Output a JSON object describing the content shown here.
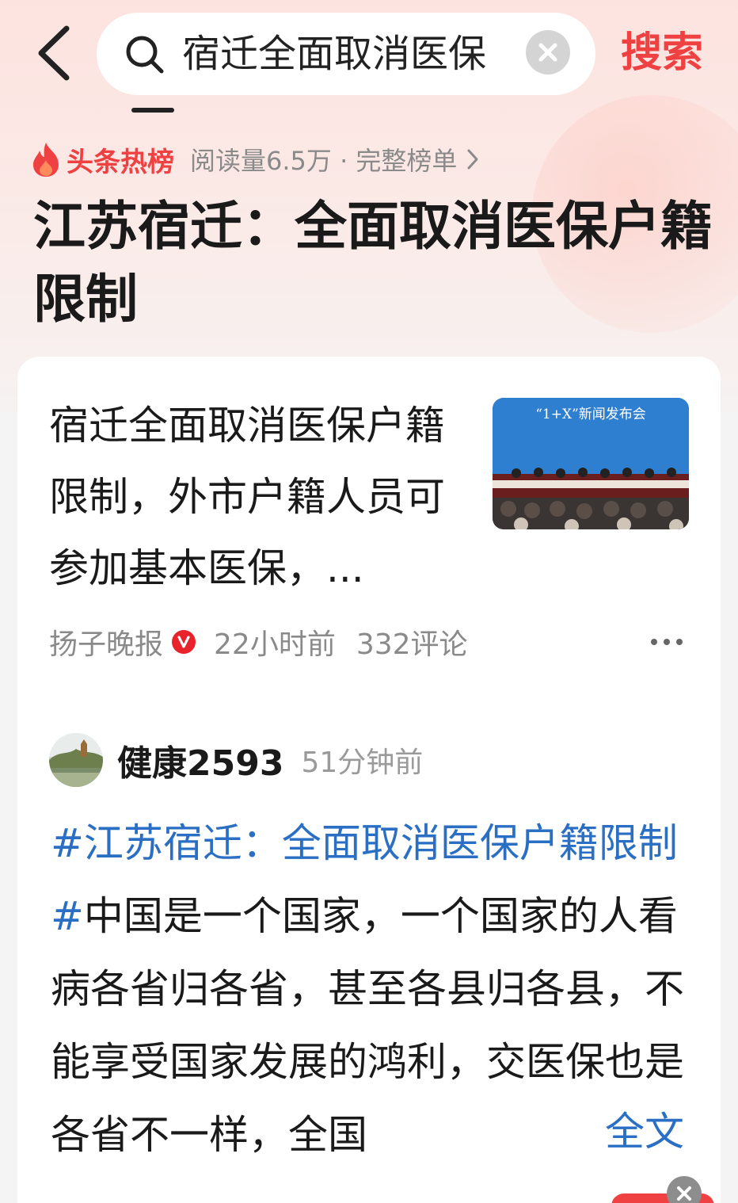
{
  "search": {
    "query": "宿迁全面取消医保",
    "button_label": "搜索"
  },
  "hot": {
    "label": "头条热榜",
    "meta": "阅读量6.5万 · 完整榜单"
  },
  "topic": {
    "title": "江苏宿迁：全面取消医保户籍限制"
  },
  "article": {
    "title": "宿迁全面取消医保户籍限制，外市户籍人员可参加基本医保，...",
    "thumb_caption": "“1+X”新闻发布会",
    "source": "扬子晚报",
    "time": "22小时前",
    "comments": "332评论"
  },
  "post": {
    "author": "健康2593",
    "time": "51分钟前",
    "hashtag": "#江苏宿迁：全面取消医保户籍限制#",
    "body": "中国是一个国家，一个国家的人看病各省归各省，甚至各县归各县，不能享受国家发展的鸿利，交医保也是各省不一样，全国",
    "fulltext_label": "全文"
  },
  "colors": {
    "brand_red": "#f04142",
    "link_blue": "#2a6fc4",
    "meta_gray": "#8a8a8a"
  },
  "icons": [
    "back-icon",
    "search-icon",
    "clear-icon",
    "flame-icon",
    "chevron-right-icon",
    "verified-icon",
    "more-icon",
    "close-icon"
  ]
}
